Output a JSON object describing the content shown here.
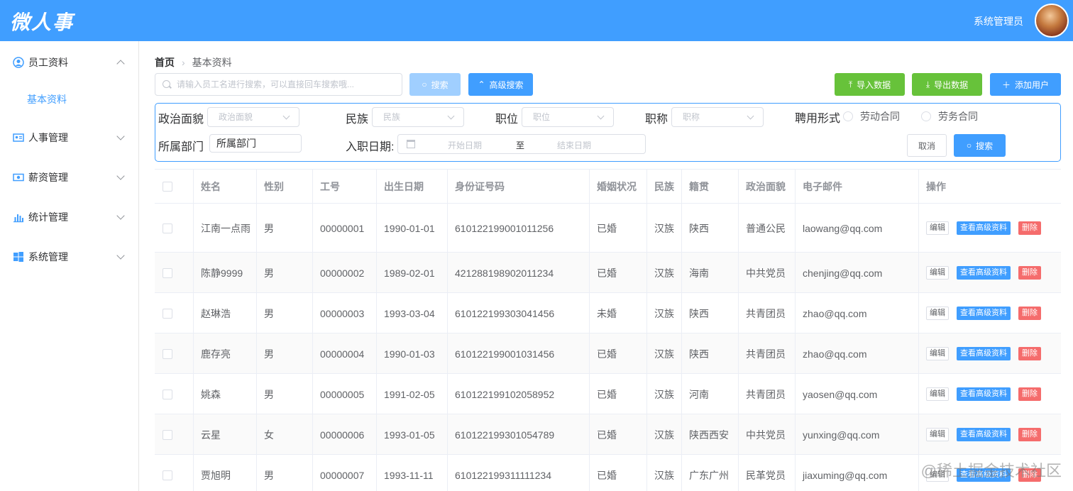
{
  "header": {
    "logo": "微人事",
    "username": "系统管理员"
  },
  "sidebar": {
    "items": [
      {
        "label": "员工资料"
      },
      {
        "label": "人事管理"
      },
      {
        "label": "薪资管理"
      },
      {
        "label": "统计管理"
      },
      {
        "label": "系统管理"
      }
    ],
    "subitem": "基本资料"
  },
  "breadcrumb": {
    "home": "首页",
    "current": "基本资料"
  },
  "toolbar": {
    "search_placeholder": "请输入员工名进行搜索，可以直接回车搜索哦...",
    "search_label": "搜索",
    "advanced_label": "高级搜索",
    "import_label": "导入数据",
    "export_label": "导出数据",
    "add_label": "添加用户"
  },
  "advanced": {
    "politic_label": "政治面貌",
    "politic_placeholder": "政治面貌",
    "nation_label": "民族",
    "nation_placeholder": "民族",
    "position_label": "职位",
    "position_placeholder": "职位",
    "title_label": "职称",
    "title_placeholder": "职称",
    "engage_label": "聘用形式",
    "engage_opt1": "劳动合同",
    "engage_opt2": "劳务合同",
    "dept_label": "所属部门",
    "dept_value": "所属部门",
    "date_label": "入职日期:",
    "date_start": "开始日期",
    "date_to": "至",
    "date_end": "结束日期",
    "cancel_label": "取消",
    "search_label": "搜索"
  },
  "table": {
    "headers": [
      "姓名",
      "性别",
      "工号",
      "出生日期",
      "身份证号码",
      "婚姻状况",
      "民族",
      "籍贯",
      "政治面貌",
      "电子邮件",
      "操作"
    ],
    "rows": [
      {
        "name": "江南一点雨",
        "gender": "男",
        "work_id": "00000001",
        "birthday": "1990-01-01",
        "id_card": "610122199001011256",
        "wedlock": "已婚",
        "nation": "汉族",
        "native_place": "陕西",
        "politic": "普通公民",
        "email": "laowang@qq.com"
      },
      {
        "name": "陈静9999",
        "gender": "男",
        "work_id": "00000002",
        "birthday": "1989-02-01",
        "id_card": "421288198902011234",
        "wedlock": "已婚",
        "nation": "汉族",
        "native_place": "海南",
        "politic": "中共党员",
        "email": "chenjing@qq.com"
      },
      {
        "name": "赵琳浩",
        "gender": "男",
        "work_id": "00000003",
        "birthday": "1993-03-04",
        "id_card": "610122199303041456",
        "wedlock": "未婚",
        "nation": "汉族",
        "native_place": "陕西",
        "politic": "共青团员",
        "email": "zhao@qq.com"
      },
      {
        "name": "鹿存亮",
        "gender": "男",
        "work_id": "00000004",
        "birthday": "1990-01-03",
        "id_card": "610122199001031456",
        "wedlock": "已婚",
        "nation": "汉族",
        "native_place": "陕西",
        "politic": "共青团员",
        "email": "zhao@qq.com"
      },
      {
        "name": "姚森",
        "gender": "男",
        "work_id": "00000005",
        "birthday": "1991-02-05",
        "id_card": "610122199102058952",
        "wedlock": "已婚",
        "nation": "汉族",
        "native_place": "河南",
        "politic": "共青团员",
        "email": "yaosen@qq.com"
      },
      {
        "name": "云星",
        "gender": "女",
        "work_id": "00000006",
        "birthday": "1993-01-05",
        "id_card": "610122199301054789",
        "wedlock": "已婚",
        "nation": "汉族",
        "native_place": "陕西西安",
        "politic": "中共党员",
        "email": "yunxing@qq.com"
      },
      {
        "name": "贾旭明",
        "gender": "男",
        "work_id": "00000007",
        "birthday": "1993-11-11",
        "id_card": "610122199311111234",
        "wedlock": "已婚",
        "nation": "汉族",
        "native_place": "广东广州",
        "politic": "民革党员",
        "email": "jiaxuming@qq.com"
      }
    ],
    "ops": {
      "edit": "编辑",
      "view": "查看高级资料",
      "delete": "删除"
    }
  },
  "watermark": "@稀土掘金技术社区",
  "colors": {
    "primary": "#409eff",
    "success": "#67c23a",
    "danger": "#f56c6c"
  }
}
